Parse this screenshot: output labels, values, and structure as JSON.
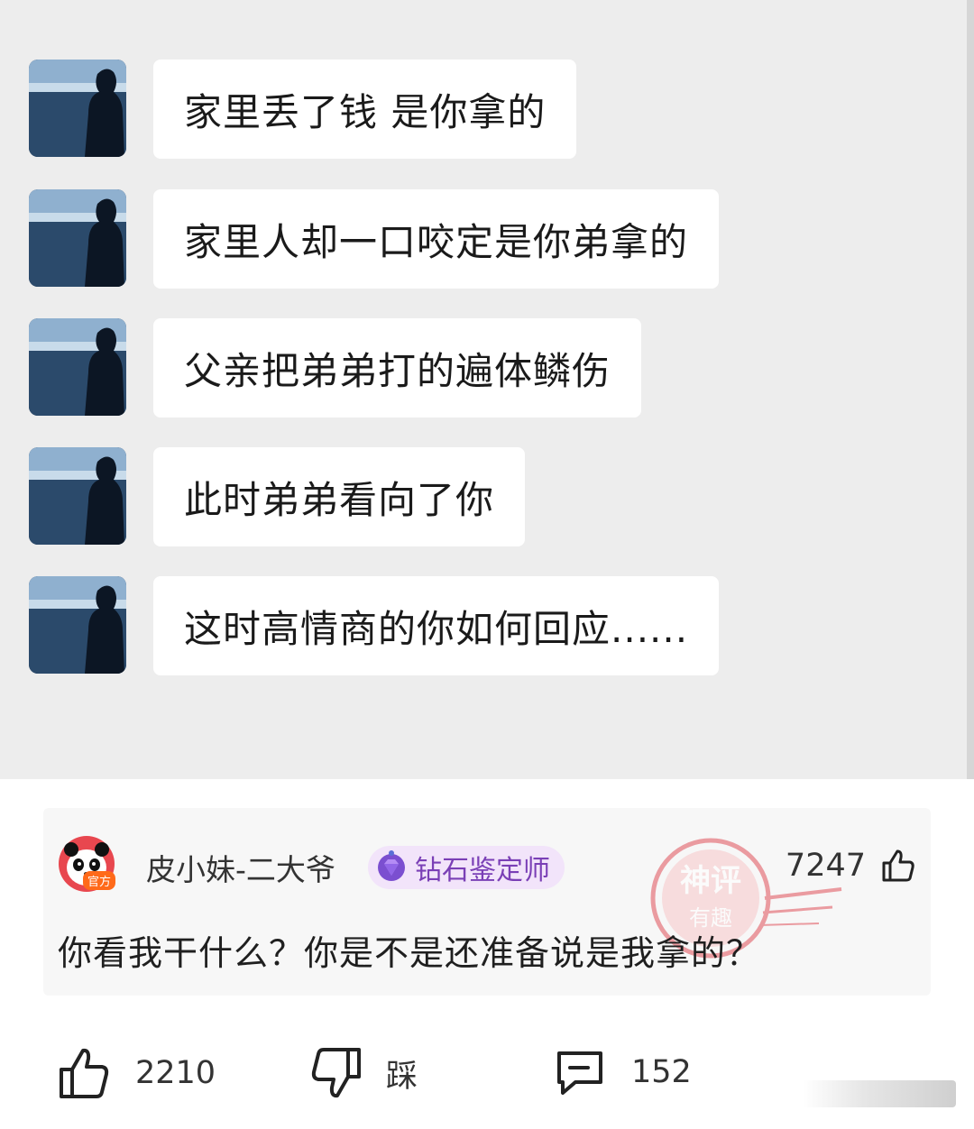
{
  "chat": {
    "messages": [
      {
        "text": "家里丢了钱  是你拿的"
      },
      {
        "text": "家里人却一口咬定是你弟拿的"
      },
      {
        "text": "父亲把弟弟打的遍体鳞伤"
      },
      {
        "text": "此时弟弟看向了你"
      },
      {
        "text": "这时高情商的你如何回应......"
      }
    ]
  },
  "comment": {
    "avatar_tag": "官方",
    "username": "皮小妹-二大爷",
    "badge": "钻石鉴定师",
    "like_count": "7247",
    "text": "你看我干什么？你是不是还准备说是我拿的？",
    "stamp_top": "神评",
    "stamp_bottom": "有趣"
  },
  "actions": {
    "like_count": "2210",
    "dislike_label": "踩",
    "comment_count": "152"
  },
  "colors": {
    "chat_background": "#ededed",
    "bubble": "#ffffff",
    "badge_background": "#f2e4fa",
    "badge_text": "#7a3fb6",
    "stamp": "#e0505a"
  },
  "icons": [
    "thumbs-up-icon",
    "thumbs-down-icon",
    "comment-icon",
    "diamond-badge-icon",
    "panda-avatar-icon"
  ]
}
